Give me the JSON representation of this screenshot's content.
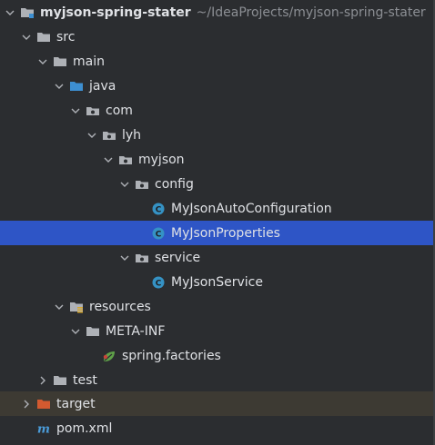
{
  "colors": {
    "background": "#2b2d30",
    "selection": "#2e55c6",
    "excluded_row": "#3d3a33",
    "text": "#dfe1e5",
    "muted": "#8c8f94",
    "folder": "#aeb1b6",
    "source_folder": "#3d8fd1",
    "excluded_folder": "#d35a30",
    "class_icon": "#3592c4",
    "spring_icon": "#5fa048",
    "maven_icon": "#4a9bd8"
  },
  "tree": {
    "project": {
      "label": "myjson-spring-stater",
      "path": "~/IdeaProjects/myjson-spring-stater",
      "icon": "module-folder-icon"
    },
    "src": {
      "label": "src",
      "icon": "folder-icon"
    },
    "main": {
      "label": "main",
      "icon": "folder-icon"
    },
    "java": {
      "label": "java",
      "icon": "source-root-folder-icon"
    },
    "com": {
      "label": "com",
      "icon": "package-icon"
    },
    "lyh": {
      "label": "lyh",
      "icon": "package-icon"
    },
    "myjson": {
      "label": "myjson",
      "icon": "package-icon"
    },
    "config": {
      "label": "config",
      "icon": "package-icon"
    },
    "autoconfig": {
      "label": "MyJsonAutoConfiguration",
      "icon": "java-class-icon"
    },
    "properties": {
      "label": "MyJsonProperties",
      "icon": "java-class-icon"
    },
    "service_pkg": {
      "label": "service",
      "icon": "package-icon"
    },
    "service_class": {
      "label": "MyJsonService",
      "icon": "java-class-icon"
    },
    "resources": {
      "label": "resources",
      "icon": "resources-folder-icon"
    },
    "metainf": {
      "label": "META-INF",
      "icon": "folder-icon"
    },
    "factories": {
      "label": "spring.factories",
      "icon": "spring-icon"
    },
    "test": {
      "label": "test",
      "icon": "folder-icon"
    },
    "target": {
      "label": "target",
      "icon": "excluded-folder-icon"
    },
    "pom": {
      "label": "pom.xml",
      "icon": "maven-icon"
    }
  }
}
